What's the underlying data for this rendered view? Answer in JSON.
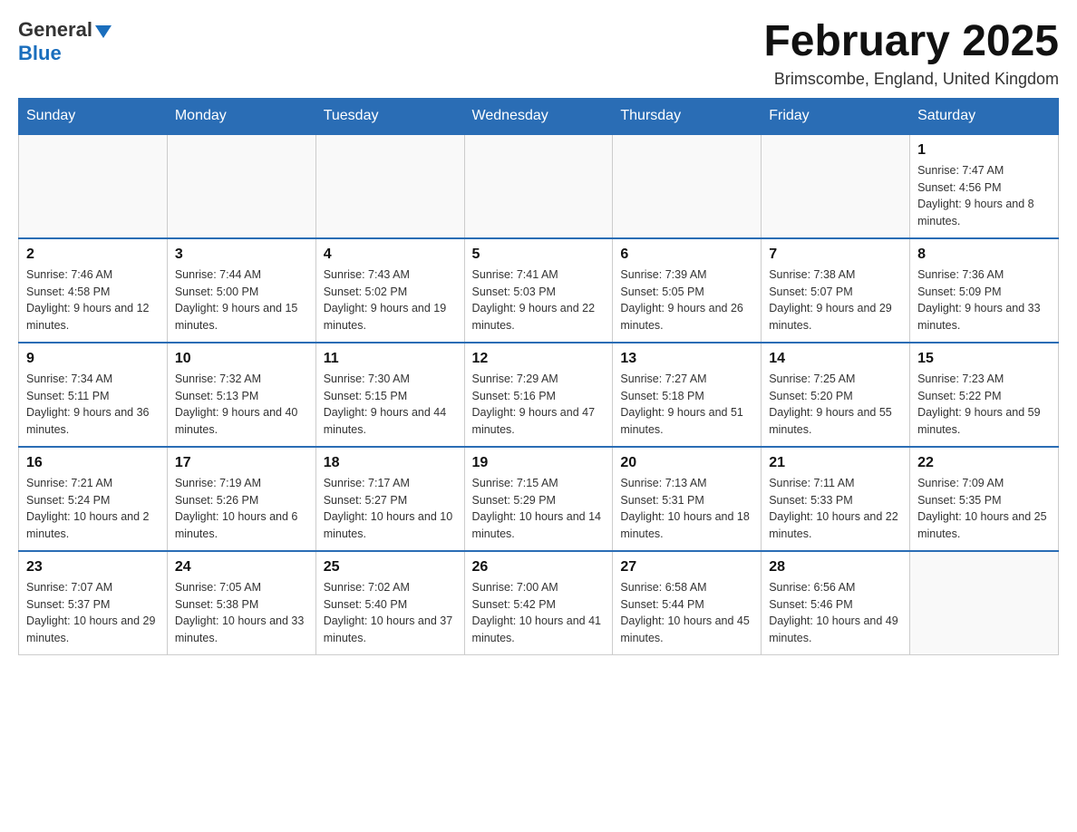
{
  "header": {
    "logo": {
      "general": "General",
      "blue": "Blue",
      "triangle": "▶"
    },
    "title": "February 2025",
    "location": "Brimscombe, England, United Kingdom"
  },
  "weekdays": [
    "Sunday",
    "Monday",
    "Tuesday",
    "Wednesday",
    "Thursday",
    "Friday",
    "Saturday"
  ],
  "weeks": [
    {
      "days": [
        {
          "num": "",
          "info": ""
        },
        {
          "num": "",
          "info": ""
        },
        {
          "num": "",
          "info": ""
        },
        {
          "num": "",
          "info": ""
        },
        {
          "num": "",
          "info": ""
        },
        {
          "num": "",
          "info": ""
        },
        {
          "num": "1",
          "info": "Sunrise: 7:47 AM\nSunset: 4:56 PM\nDaylight: 9 hours and 8 minutes."
        }
      ]
    },
    {
      "days": [
        {
          "num": "2",
          "info": "Sunrise: 7:46 AM\nSunset: 4:58 PM\nDaylight: 9 hours and 12 minutes."
        },
        {
          "num": "3",
          "info": "Sunrise: 7:44 AM\nSunset: 5:00 PM\nDaylight: 9 hours and 15 minutes."
        },
        {
          "num": "4",
          "info": "Sunrise: 7:43 AM\nSunset: 5:02 PM\nDaylight: 9 hours and 19 minutes."
        },
        {
          "num": "5",
          "info": "Sunrise: 7:41 AM\nSunset: 5:03 PM\nDaylight: 9 hours and 22 minutes."
        },
        {
          "num": "6",
          "info": "Sunrise: 7:39 AM\nSunset: 5:05 PM\nDaylight: 9 hours and 26 minutes."
        },
        {
          "num": "7",
          "info": "Sunrise: 7:38 AM\nSunset: 5:07 PM\nDaylight: 9 hours and 29 minutes."
        },
        {
          "num": "8",
          "info": "Sunrise: 7:36 AM\nSunset: 5:09 PM\nDaylight: 9 hours and 33 minutes."
        }
      ]
    },
    {
      "days": [
        {
          "num": "9",
          "info": "Sunrise: 7:34 AM\nSunset: 5:11 PM\nDaylight: 9 hours and 36 minutes."
        },
        {
          "num": "10",
          "info": "Sunrise: 7:32 AM\nSunset: 5:13 PM\nDaylight: 9 hours and 40 minutes."
        },
        {
          "num": "11",
          "info": "Sunrise: 7:30 AM\nSunset: 5:15 PM\nDaylight: 9 hours and 44 minutes."
        },
        {
          "num": "12",
          "info": "Sunrise: 7:29 AM\nSunset: 5:16 PM\nDaylight: 9 hours and 47 minutes."
        },
        {
          "num": "13",
          "info": "Sunrise: 7:27 AM\nSunset: 5:18 PM\nDaylight: 9 hours and 51 minutes."
        },
        {
          "num": "14",
          "info": "Sunrise: 7:25 AM\nSunset: 5:20 PM\nDaylight: 9 hours and 55 minutes."
        },
        {
          "num": "15",
          "info": "Sunrise: 7:23 AM\nSunset: 5:22 PM\nDaylight: 9 hours and 59 minutes."
        }
      ]
    },
    {
      "days": [
        {
          "num": "16",
          "info": "Sunrise: 7:21 AM\nSunset: 5:24 PM\nDaylight: 10 hours and 2 minutes."
        },
        {
          "num": "17",
          "info": "Sunrise: 7:19 AM\nSunset: 5:26 PM\nDaylight: 10 hours and 6 minutes."
        },
        {
          "num": "18",
          "info": "Sunrise: 7:17 AM\nSunset: 5:27 PM\nDaylight: 10 hours and 10 minutes."
        },
        {
          "num": "19",
          "info": "Sunrise: 7:15 AM\nSunset: 5:29 PM\nDaylight: 10 hours and 14 minutes."
        },
        {
          "num": "20",
          "info": "Sunrise: 7:13 AM\nSunset: 5:31 PM\nDaylight: 10 hours and 18 minutes."
        },
        {
          "num": "21",
          "info": "Sunrise: 7:11 AM\nSunset: 5:33 PM\nDaylight: 10 hours and 22 minutes."
        },
        {
          "num": "22",
          "info": "Sunrise: 7:09 AM\nSunset: 5:35 PM\nDaylight: 10 hours and 25 minutes."
        }
      ]
    },
    {
      "days": [
        {
          "num": "23",
          "info": "Sunrise: 7:07 AM\nSunset: 5:37 PM\nDaylight: 10 hours and 29 minutes."
        },
        {
          "num": "24",
          "info": "Sunrise: 7:05 AM\nSunset: 5:38 PM\nDaylight: 10 hours and 33 minutes."
        },
        {
          "num": "25",
          "info": "Sunrise: 7:02 AM\nSunset: 5:40 PM\nDaylight: 10 hours and 37 minutes."
        },
        {
          "num": "26",
          "info": "Sunrise: 7:00 AM\nSunset: 5:42 PM\nDaylight: 10 hours and 41 minutes."
        },
        {
          "num": "27",
          "info": "Sunrise: 6:58 AM\nSunset: 5:44 PM\nDaylight: 10 hours and 45 minutes."
        },
        {
          "num": "28",
          "info": "Sunrise: 6:56 AM\nSunset: 5:46 PM\nDaylight: 10 hours and 49 minutes."
        },
        {
          "num": "",
          "info": ""
        }
      ]
    }
  ]
}
